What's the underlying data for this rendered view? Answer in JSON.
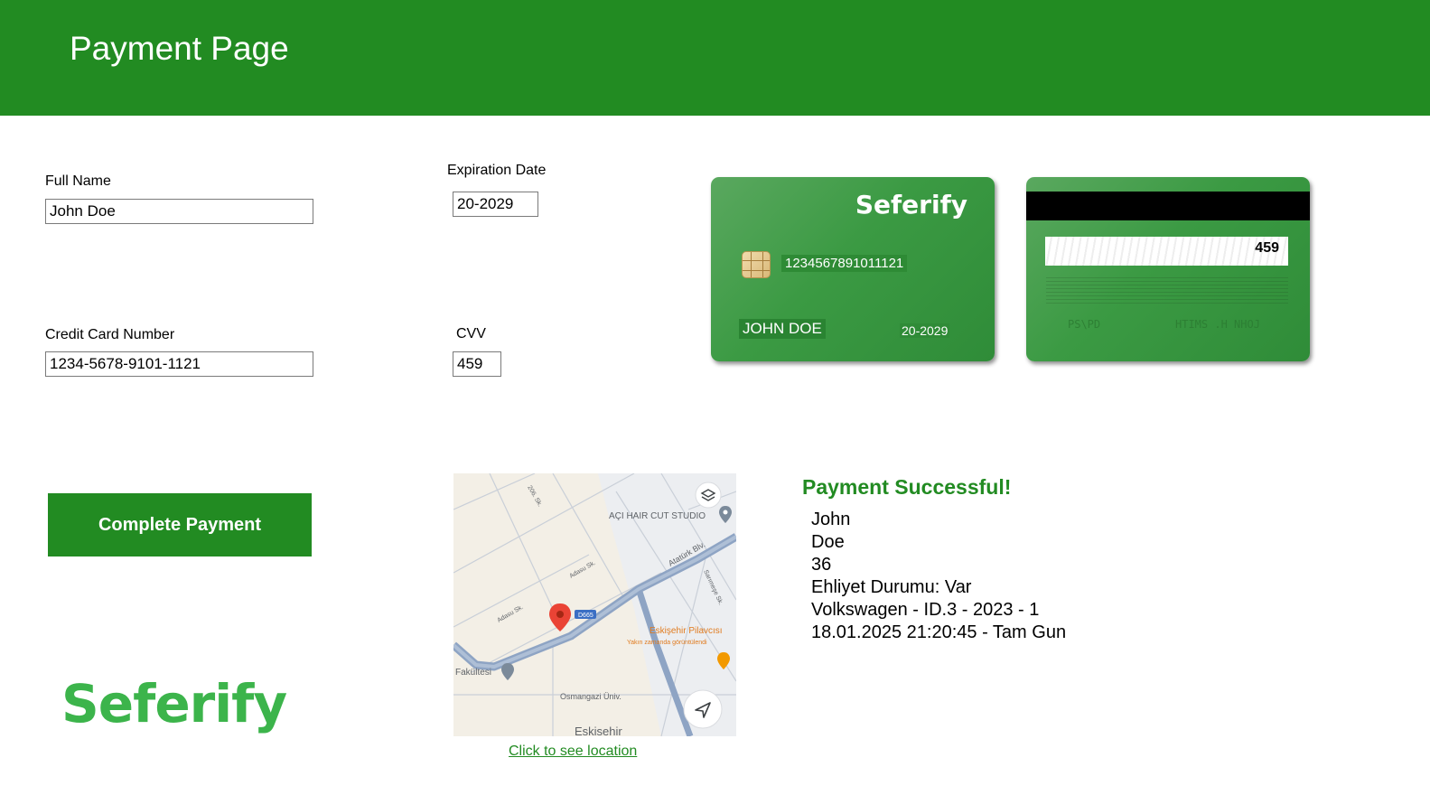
{
  "header": {
    "title": "Payment Page",
    "bg_color": "#228b22"
  },
  "form": {
    "full_name": {
      "label": "Full Name",
      "value": "John Doe"
    },
    "expiration": {
      "label": "Expiration Date",
      "value": "20-2029"
    },
    "card_number": {
      "label": "Credit Card Number",
      "value": "1234-5678-9101-1121"
    },
    "cvv": {
      "label": "CVV",
      "value": "459"
    }
  },
  "complete_button": {
    "label": "Complete Payment"
  },
  "logo": {
    "text": "Seferify"
  },
  "card_front": {
    "brand": "Seferify",
    "number": "1234567891011121",
    "holder": "JOHN DOE",
    "expiry": "20-2029"
  },
  "card_back": {
    "cvv": "459",
    "deco_left": "PS\\PD",
    "deco_right": "HTIMS .H NHOJ"
  },
  "map": {
    "labels": {
      "hair_studio": "AÇI HAIR CUT STUDIO",
      "ataturk": "Atatürk Blv.",
      "adasu": "Adasu Sk.",
      "adasu2": "Adasu Sk.",
      "s206": "206. Sk.",
      "sarimese": "Sarımeşe Sk.",
      "d665": "D665",
      "pilavcisi": "Eskişehir Pilavcısı",
      "pilavcisi_sub": "Yakın zamanda görüntülendi",
      "fakultesi": "Fakültesi",
      "osmangazi": "Osmangazi Üniv.",
      "eskisehir": "Eskisehir"
    },
    "link_text": "Click to see location"
  },
  "result": {
    "title": "Payment Successful!",
    "lines": [
      "John",
      "Doe",
      "36",
      "Ehliyet Durumu: Var",
      "Volkswagen - ID.3 - 2023 - 1",
      "18.01.2025 21:20:45 - Tam Gun"
    ]
  },
  "colors": {
    "accent": "#228b22",
    "logo": "#3cb44b",
    "card": "#3b9a43"
  }
}
